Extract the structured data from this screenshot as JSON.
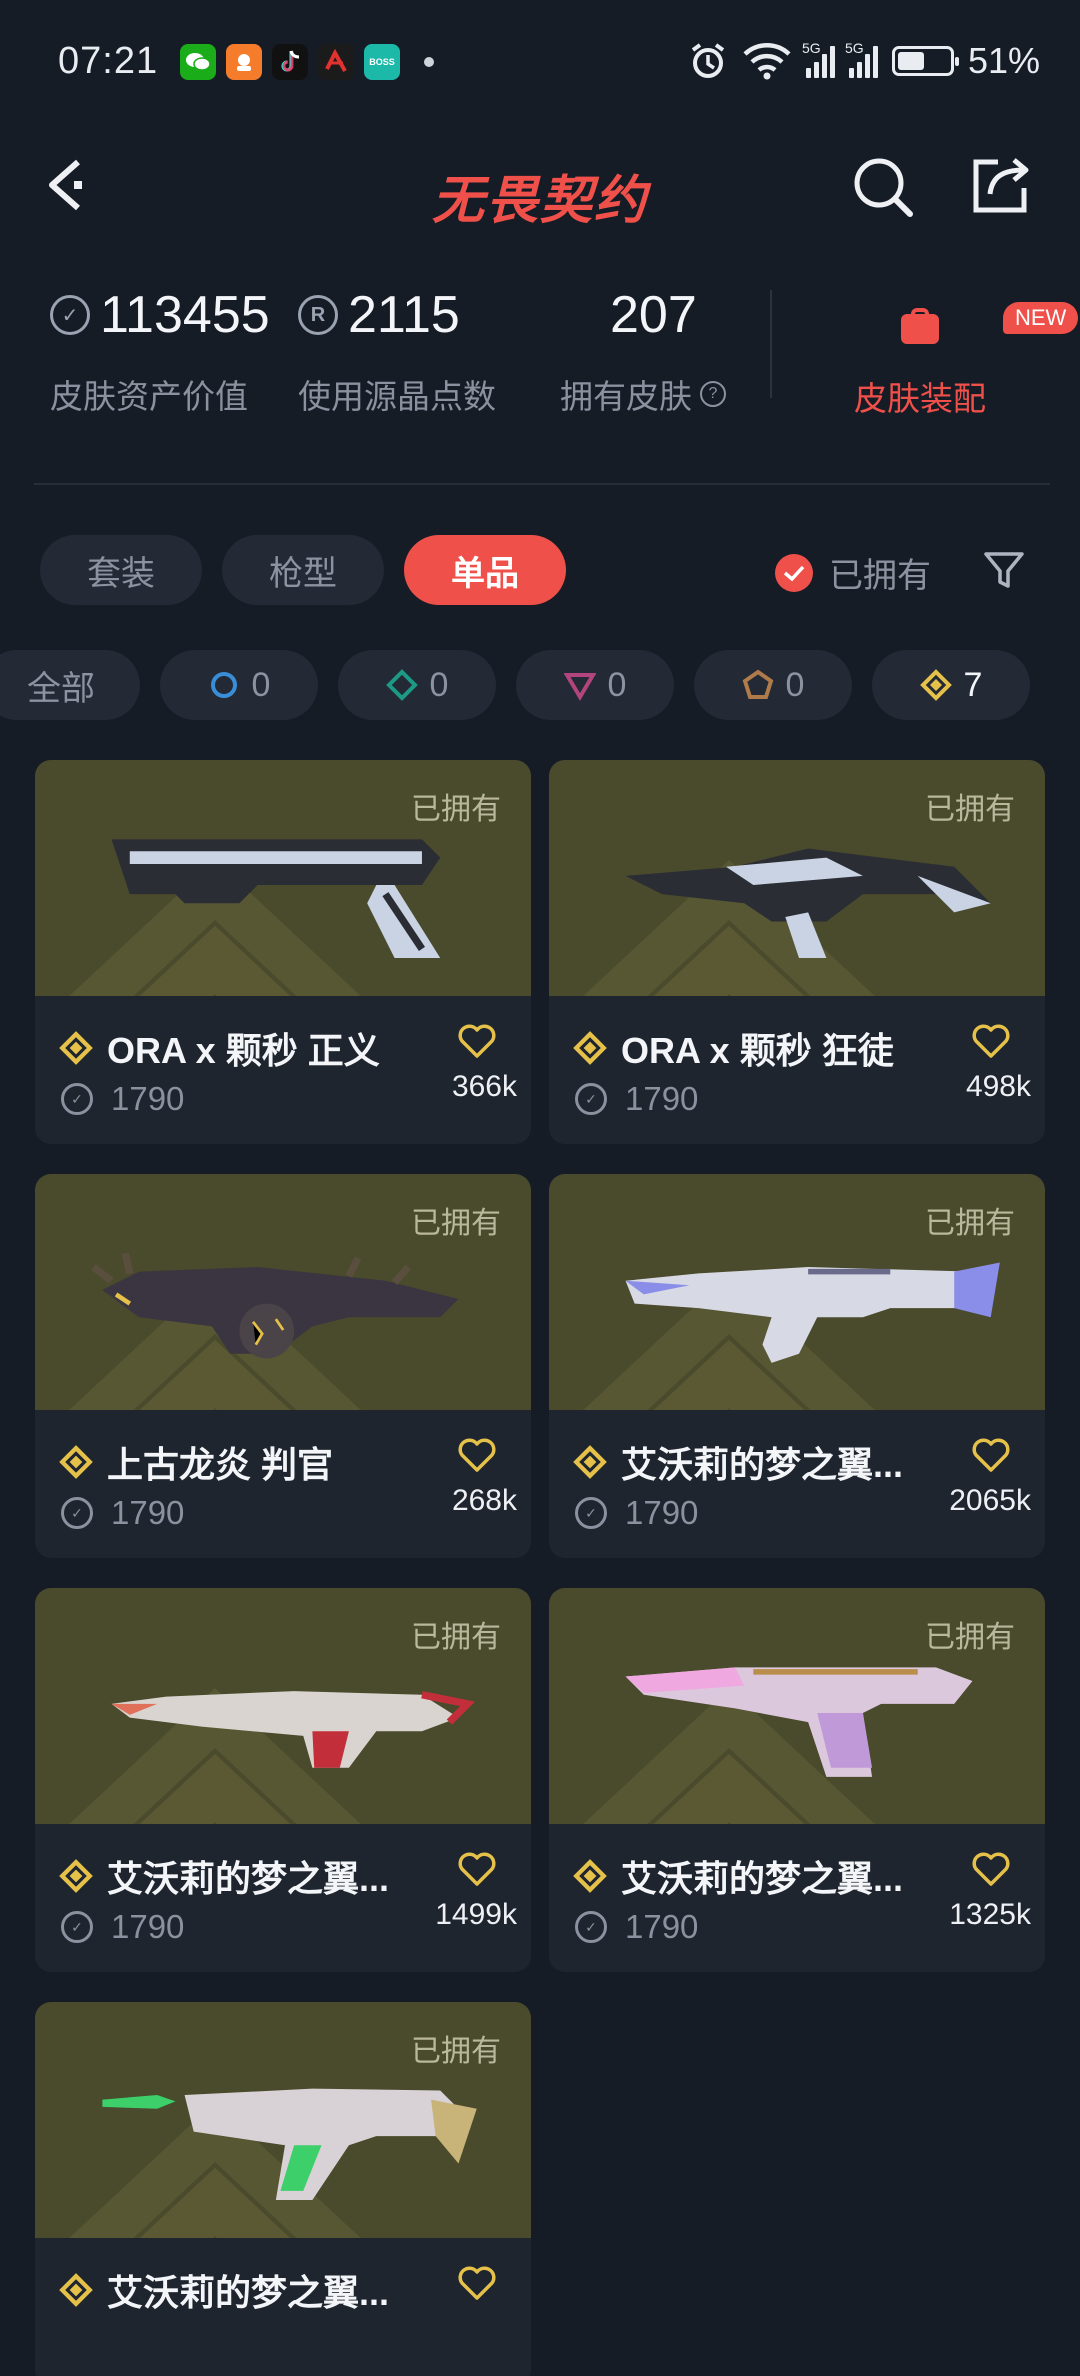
{
  "status_bar": {
    "time": "07:21",
    "apps": [
      {
        "name": "wechat-icon",
        "color": "#1aad19"
      },
      {
        "name": "app-orange-icon",
        "color": "#f57c2b"
      },
      {
        "name": "tiktok-icon",
        "color": "#111111"
      },
      {
        "name": "app-red-icon",
        "color": "#d8262b"
      },
      {
        "name": "boss-icon",
        "color": "#1cb9a8",
        "text": "BOSS"
      }
    ],
    "network_a": "5G",
    "network_b": "5G",
    "battery_percent": "51%",
    "battery_level": 0.51
  },
  "header": {
    "title": "无畏契约"
  },
  "stats": {
    "asset_value": "113455",
    "asset_label": "皮肤资产价值",
    "points_used": "2115",
    "points_label": "使用源晶点数",
    "owned_count": "207",
    "owned_label": "拥有皮肤",
    "help_symbol": "?",
    "equip_badge": "NEW",
    "equip_label": "皮肤装配"
  },
  "tabs": [
    {
      "label": "套装",
      "active": false
    },
    {
      "label": "枪型",
      "active": false
    },
    {
      "label": "单品",
      "active": true
    }
  ],
  "owned_filter_label": "已拥有",
  "tiers": [
    {
      "label": "全部",
      "count": "",
      "icon": "all"
    },
    {
      "label": "",
      "count": "0",
      "icon": "select-tier-icon"
    },
    {
      "label": "",
      "count": "0",
      "icon": "deluxe-tier-icon"
    },
    {
      "label": "",
      "count": "0",
      "icon": "premium-tier-icon"
    },
    {
      "label": "",
      "count": "0",
      "icon": "exclusive-tier-icon"
    },
    {
      "label": "",
      "count": "7",
      "icon": "ultra-tier-icon"
    }
  ],
  "colors": {
    "accent": "#f0504a",
    "ultra_gold": "#e6c14a",
    "card_image_bg": "#4a4a2c",
    "background": "#161c26"
  },
  "skins": [
    {
      "name": "ORA x 颗秒 正义",
      "price": "1790",
      "likes": "366k",
      "owned_tag": "已拥有",
      "gun": "pistol-dark"
    },
    {
      "name": "ORA x 颗秒 狂徒",
      "price": "1790",
      "likes": "498k",
      "owned_tag": "已拥有",
      "gun": "rifle-dark"
    },
    {
      "name": "上古龙炎 判官",
      "price": "1790",
      "likes": "268k",
      "owned_tag": "已拥有",
      "gun": "shotgun-dragon"
    },
    {
      "name": "艾沃莉的梦之翼...",
      "price": "1790",
      "likes": "2065k",
      "owned_tag": "已拥有",
      "gun": "smg-blue"
    },
    {
      "name": "艾沃莉的梦之翼...",
      "price": "1790",
      "likes": "1499k",
      "owned_tag": "已拥有",
      "gun": "rifle-red"
    },
    {
      "name": "艾沃莉的梦之翼...",
      "price": "1790",
      "likes": "1325k",
      "owned_tag": "已拥有",
      "gun": "pistol-pink"
    },
    {
      "name": "艾沃莉的梦之翼...",
      "price": "",
      "likes": "",
      "owned_tag": "已拥有",
      "gun": "smg-green"
    }
  ]
}
